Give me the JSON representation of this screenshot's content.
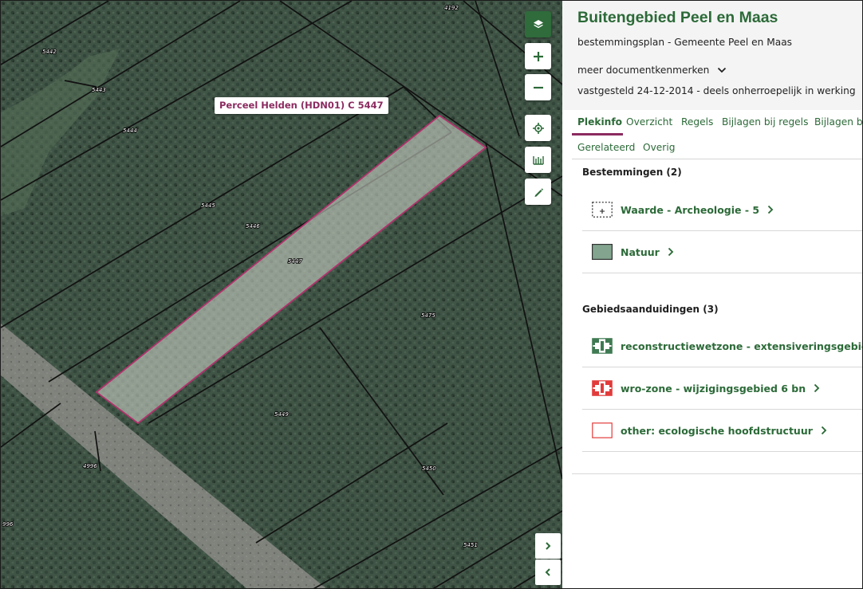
{
  "map": {
    "tooltip": "Perceel Helden (HDN01) C 5447",
    "parcel_numbers": [
      "4192",
      "5442",
      "5443",
      "5444",
      "5445",
      "5446",
      "5447",
      "5475",
      "5449",
      "5450",
      "5451",
      "4996",
      "996"
    ],
    "buttons": {
      "layers": "layers-icon",
      "zoom_in": "+",
      "zoom_out": "−",
      "locate": "locate-icon",
      "measure": "measure-icon",
      "draw": "pencil-icon"
    },
    "nav": {
      "expand": "›",
      "collapse": "‹"
    }
  },
  "panel": {
    "title": "Buitengebied Peel en Maas",
    "subtitle": "bestemmingsplan - Gemeente Peel en Maas",
    "more_label": "meer documentkenmerken",
    "status": "vastgesteld 24-12-2014 - deels onherroepelijk in werking",
    "tabs": [
      "Plekinfo",
      "Overzicht",
      "Regels",
      "Bijlagen bij regels",
      "Bijlagen b",
      "Gerelateerd",
      "Overig"
    ],
    "active_tab": "Plekinfo",
    "sections": [
      {
        "title": "Bestemmingen (2)",
        "items": [
          {
            "label": "Waarde - Archeologie - 5",
            "swatch": "archeologie-swatch"
          },
          {
            "label": "Natuur",
            "swatch": "natuur-swatch"
          }
        ]
      },
      {
        "title": "Gebiedsaanduidingen (3)",
        "items": [
          {
            "label": "reconstructiewetzone - extensiveringsgebied",
            "swatch": "reconstructie-swatch"
          },
          {
            "label": "wro-zone - wijzigingsgebied 6 bn",
            "swatch": "wro-swatch"
          },
          {
            "label": "other: ecologische hoofdstructuur",
            "swatch": "ehs-swatch"
          }
        ]
      }
    ]
  },
  "colors": {
    "accent_green": "#2c6a38",
    "accent_magenta": "#8b2b60",
    "natuur_fill": "#83a58f",
    "wro_red": "#e23b3b"
  }
}
